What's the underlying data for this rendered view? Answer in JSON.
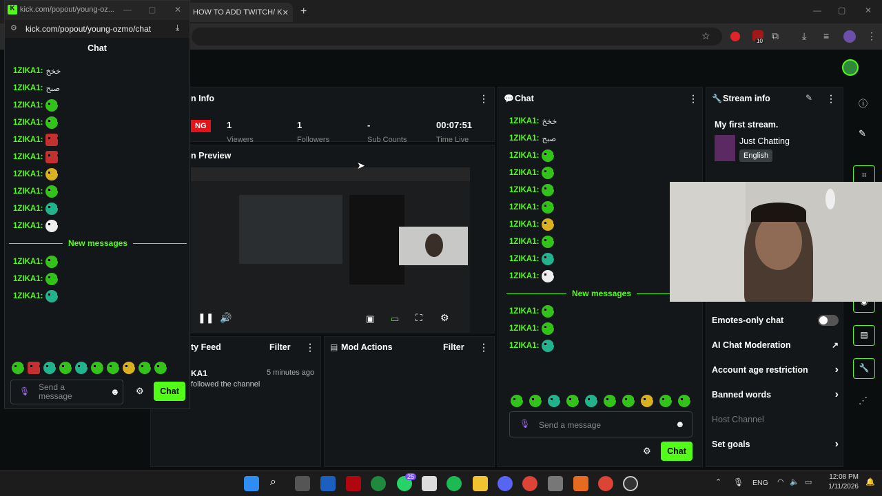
{
  "browser": {
    "tab_active_title": "HOW TO ADD TWITCH/ K",
    "tab_close": "✕",
    "new_tab": "+",
    "extensions_badge": "10"
  },
  "popout": {
    "url_title": "kick.com/popout/young-oz...",
    "url": "kick.com/popout/young-ozmo/chat",
    "header": "Chat",
    "messages": [
      {
        "user": "1ZIKA1:",
        "text": "خخخ",
        "emote": ""
      },
      {
        "user": "1ZIKA1:",
        "text": "صبح",
        "emote": ""
      },
      {
        "user": "1ZIKA1:",
        "text": "",
        "emote": "green"
      },
      {
        "user": "1ZIKA1:",
        "text": "",
        "emote": "green"
      },
      {
        "user": "1ZIKA1:",
        "text": "",
        "emote": "red"
      },
      {
        "user": "1ZIKA1:",
        "text": "",
        "emote": "red"
      },
      {
        "user": "1ZIKA1:",
        "text": "",
        "emote": "yellow"
      },
      {
        "user": "1ZIKA1:",
        "text": "",
        "emote": "green"
      },
      {
        "user": "1ZIKA1:",
        "text": "",
        "emote": "teal"
      },
      {
        "user": "1ZIKA1:",
        "text": "",
        "emote": "white"
      }
    ],
    "new_messages_label": "New messages",
    "new_messages": [
      {
        "user": "1ZIKA1:",
        "emote": "green"
      },
      {
        "user": "1ZIKA1:",
        "emote": "green"
      },
      {
        "user": "1ZIKA1:",
        "emote": "teal"
      }
    ],
    "input_placeholder": "Send a message",
    "chat_button": "Chat"
  },
  "dashboard": {
    "session_info_title": "n Info",
    "live_badge": "NG",
    "stats": [
      "1",
      "1",
      "-",
      "00:07:51"
    ],
    "stats_labels": [
      "Viewers",
      "Followers",
      "Sub Counts",
      "Time Live"
    ],
    "preview_title": "n Preview",
    "activity_title": "ty Feed",
    "activity_filter": "Filter",
    "activity_user": "KA1",
    "activity_time": "5 minutes ago",
    "activity_text": "followed the channel",
    "mod_actions_title": "Mod Actions",
    "mod_filter": "Filter",
    "chat_title": "Chat",
    "chat_messages": [
      {
        "user": "1ZIKA1:",
        "text": "خخخ",
        "emote": ""
      },
      {
        "user": "1ZIKA1:",
        "text": "صبح",
        "emote": ""
      },
      {
        "user": "1ZIKA1:",
        "text": "",
        "emote": "green"
      },
      {
        "user": "1ZIKA1:",
        "text": "",
        "emote": "green"
      },
      {
        "user": "1ZIKA1:",
        "text": "",
        "emote": "green"
      },
      {
        "user": "1ZIKA1:",
        "text": "",
        "emote": "green"
      },
      {
        "user": "1ZIKA1:",
        "text": "",
        "emote": "yellow"
      },
      {
        "user": "1ZIKA1:",
        "text": "",
        "emote": "green"
      },
      {
        "user": "1ZIKA1:",
        "text": "",
        "emote": "teal"
      },
      {
        "user": "1ZIKA1:",
        "text": "",
        "emote": "white"
      }
    ],
    "new_messages_label": "New messages",
    "new_messages": [
      {
        "user": "1ZIKA1:",
        "emote": "green"
      },
      {
        "user": "1ZIKA1:",
        "emote": "green"
      },
      {
        "user": "1ZIKA1:",
        "emote": "teal"
      }
    ],
    "input_placeholder": "Send a message",
    "chat_button": "Chat",
    "stream_info_title": "Stream info",
    "stream_title": "My first stream.",
    "category": "Just Chatting",
    "language": "English",
    "settings": [
      {
        "label": "Emotes-only chat",
        "type": "toggle"
      },
      {
        "label": "AI Chat Moderation",
        "type": "external"
      },
      {
        "label": "Account age restriction",
        "type": "chevron"
      },
      {
        "label": "Banned words",
        "type": "chevron"
      },
      {
        "label": "Host Channel",
        "type": "disabled"
      },
      {
        "label": "Set goals",
        "type": "chevron"
      }
    ]
  },
  "taskbar": {
    "language": "ENG",
    "time": "12:08 PM",
    "date": "1/11/2026",
    "whatsapp_badge": "25"
  },
  "colors": {
    "kick_green": "#53fc18",
    "panel": "#141719",
    "bg": "#0b0e0f"
  }
}
